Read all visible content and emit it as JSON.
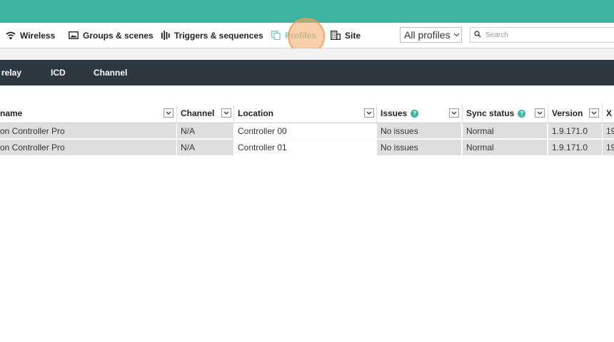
{
  "nav": {
    "items": [
      {
        "label": "Wireless",
        "icon": "wifi-icon"
      },
      {
        "label": "Groups & scenes",
        "icon": "image-icon"
      },
      {
        "label": "Triggers & sequences",
        "icon": "bars-icon"
      },
      {
        "label": "Profiles",
        "icon": "profiles-icon",
        "active": true
      },
      {
        "label": "Site",
        "icon": "building-icon"
      }
    ],
    "profile_select": "All profiles",
    "search_placeholder": "Search"
  },
  "tabs": [
    "relay",
    "ICD",
    "Channel"
  ],
  "table": {
    "columns": [
      "name",
      "Channel",
      "Location",
      "Issues",
      "Sync status",
      "Version",
      "X"
    ],
    "rows": [
      [
        "on Controller Pro",
        "N/A",
        "Controller 00",
        "No issues",
        "Normal",
        "1.9.171.0",
        "19"
      ],
      [
        "on Controller Pro",
        "N/A",
        "Controller 01",
        "No issues",
        "Normal",
        "1.9.171.0",
        "19"
      ]
    ]
  },
  "colors": {
    "accent": "#3db5a0",
    "tabs_bg": "#2d3840",
    "active_nav": "#7ec9b6",
    "row_gray": "#dedede"
  }
}
